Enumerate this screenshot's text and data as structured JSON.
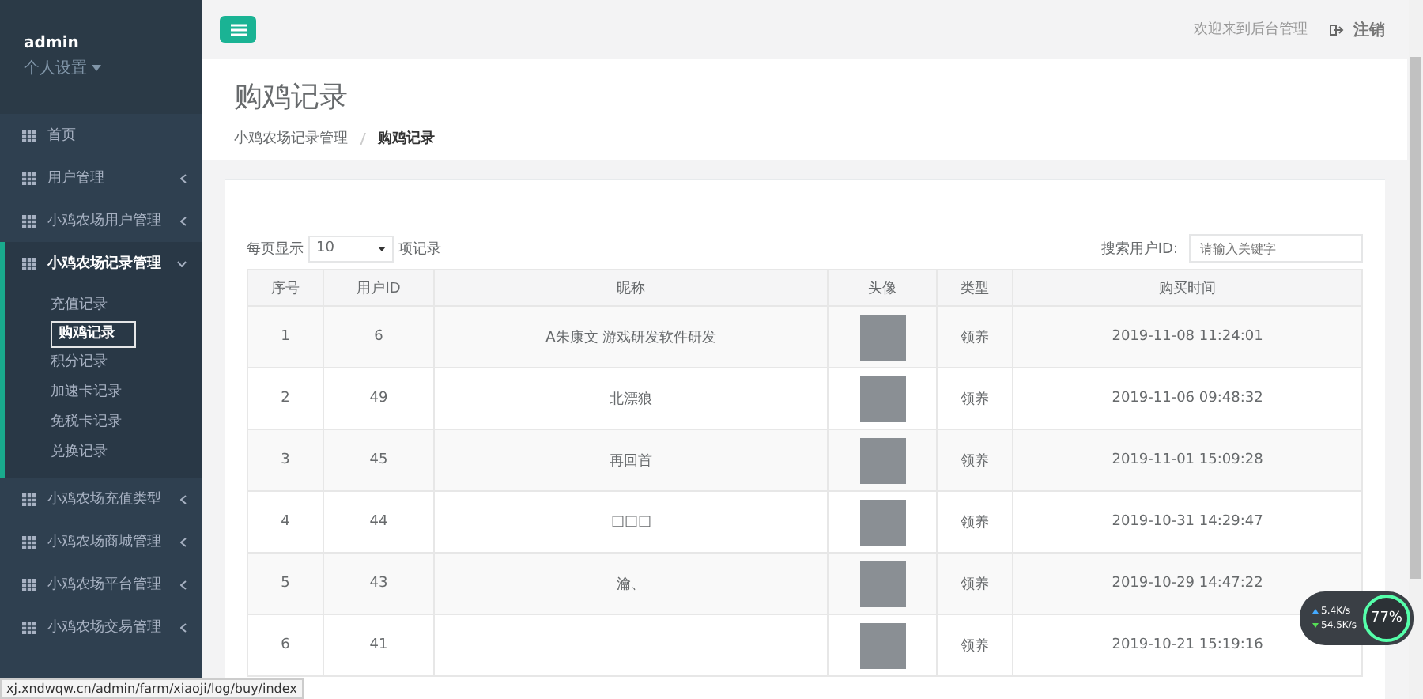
{
  "sidebar": {
    "user": "admin",
    "settings": "个人设置",
    "items": [
      {
        "label": "首页",
        "expanded": false,
        "has_arrow": false
      },
      {
        "label": "用户管理",
        "expanded": false,
        "has_arrow": true
      },
      {
        "label": "小鸡农场用户管理",
        "expanded": false,
        "has_arrow": true
      },
      {
        "label": "小鸡农场记录管理",
        "expanded": true,
        "has_arrow": true,
        "children": [
          {
            "label": "充值记录",
            "selected": false
          },
          {
            "label": "购鸡记录",
            "selected": true
          },
          {
            "label": "积分记录",
            "selected": false
          },
          {
            "label": "加速卡记录",
            "selected": false
          },
          {
            "label": "免税卡记录",
            "selected": false
          },
          {
            "label": "兑换记录",
            "selected": false
          }
        ]
      },
      {
        "label": "小鸡农场充值类型",
        "expanded": false,
        "has_arrow": true
      },
      {
        "label": "小鸡农场商城管理",
        "expanded": false,
        "has_arrow": true
      },
      {
        "label": "小鸡农场平台管理",
        "expanded": false,
        "has_arrow": true
      },
      {
        "label": "小鸡农场交易管理",
        "expanded": false,
        "has_arrow": true
      }
    ]
  },
  "topbar": {
    "welcome": "欢迎来到后台管理",
    "logout": "注销"
  },
  "page": {
    "title": "购鸡记录",
    "breadcrumb": [
      "小鸡农场记录管理",
      "购鸡记录"
    ]
  },
  "table_controls": {
    "per_page_label": "每页显示",
    "per_page": "10",
    "per_page_suffix": "项记录",
    "search_label": "搜索用户ID:",
    "search_placeholder": "请输入关键字"
  },
  "table": {
    "columns": [
      "序号",
      "用户ID",
      "昵称",
      "头像",
      "类型",
      "购买时间"
    ],
    "rows": [
      [
        "1",
        "6",
        "A朱康文 游戏研发软件研发",
        "",
        "领养",
        "2019-11-08 11:24:01"
      ],
      [
        "2",
        "49",
        "北漂狼",
        "",
        "领养",
        "2019-11-06 09:48:32"
      ],
      [
        "3",
        "45",
        "再回首",
        "",
        "领养",
        "2019-11-01 15:09:28"
      ],
      [
        "4",
        "44",
        "□□□",
        "",
        "领养",
        "2019-10-31 14:29:47"
      ],
      [
        "5",
        "43",
        "瀹、",
        "",
        "领养",
        "2019-10-29 14:47:22"
      ],
      [
        "6",
        "41",
        "",
        "",
        "领养",
        "2019-10-21 15:19:16"
      ]
    ]
  },
  "status_url": "xj.xndwqw.cn/admin/farm/xiaoji/log/buy/index",
  "net_widget": {
    "up": "5.4K/s",
    "down": "54.5K/s",
    "percent": "77%"
  }
}
